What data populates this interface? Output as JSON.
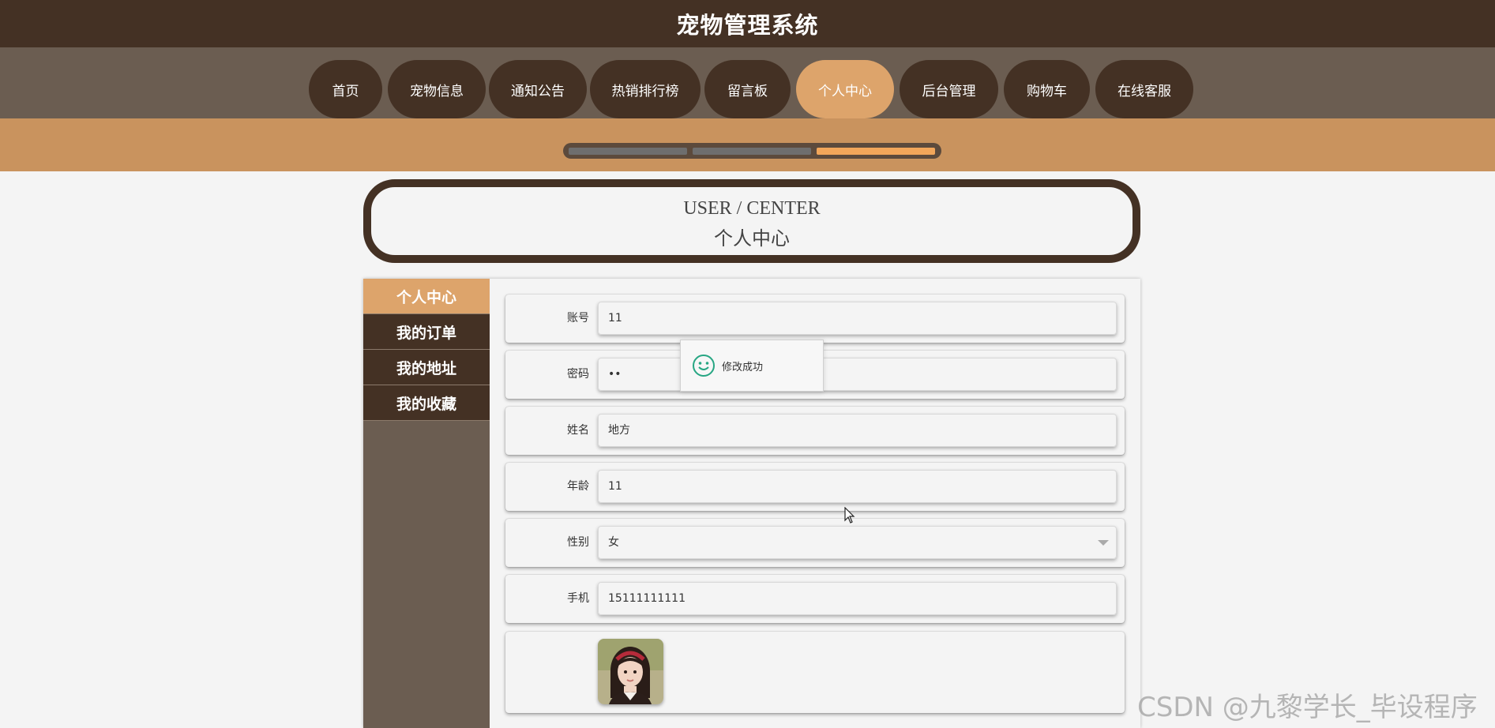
{
  "header": {
    "title": "宠物管理系统"
  },
  "nav": {
    "items": [
      {
        "label": "首页",
        "active": false
      },
      {
        "label": "宠物信息",
        "active": false
      },
      {
        "label": "通知公告",
        "active": false
      },
      {
        "label": "热销排行榜",
        "active": false
      },
      {
        "label": "留言板",
        "active": false
      },
      {
        "label": "个人中心",
        "active": true
      },
      {
        "label": "后台管理",
        "active": false
      },
      {
        "label": "购物车",
        "active": false
      },
      {
        "label": "在线客服",
        "active": false
      }
    ]
  },
  "carousel": {
    "slide_count": 3,
    "active_index": 2
  },
  "section": {
    "title_en": "USER / CENTER",
    "title_cn": "个人中心"
  },
  "sidebar": {
    "items": [
      {
        "label": "个人中心",
        "active": true
      },
      {
        "label": "我的订单",
        "active": false
      },
      {
        "label": "我的地址",
        "active": false
      },
      {
        "label": "我的收藏",
        "active": false
      }
    ]
  },
  "form": {
    "account": {
      "label": "账号",
      "value": "11"
    },
    "password": {
      "label": "密码",
      "value": "••"
    },
    "name": {
      "label": "姓名",
      "value": "地方"
    },
    "age": {
      "label": "年龄",
      "value": "11"
    },
    "gender": {
      "label": "性别",
      "value": "女"
    },
    "phone": {
      "label": "手机",
      "value": "15111111111"
    }
  },
  "toast": {
    "message": "修改成功",
    "icon": "smile-icon"
  },
  "watermark": "CSDN @九黎学长_毕设程序",
  "colors": {
    "dark_brown": "#443124",
    "nav_bg": "#6b5d51",
    "accent": "#dda46b",
    "banner": "#c9935e",
    "page_bg": "#f4f4f4"
  }
}
